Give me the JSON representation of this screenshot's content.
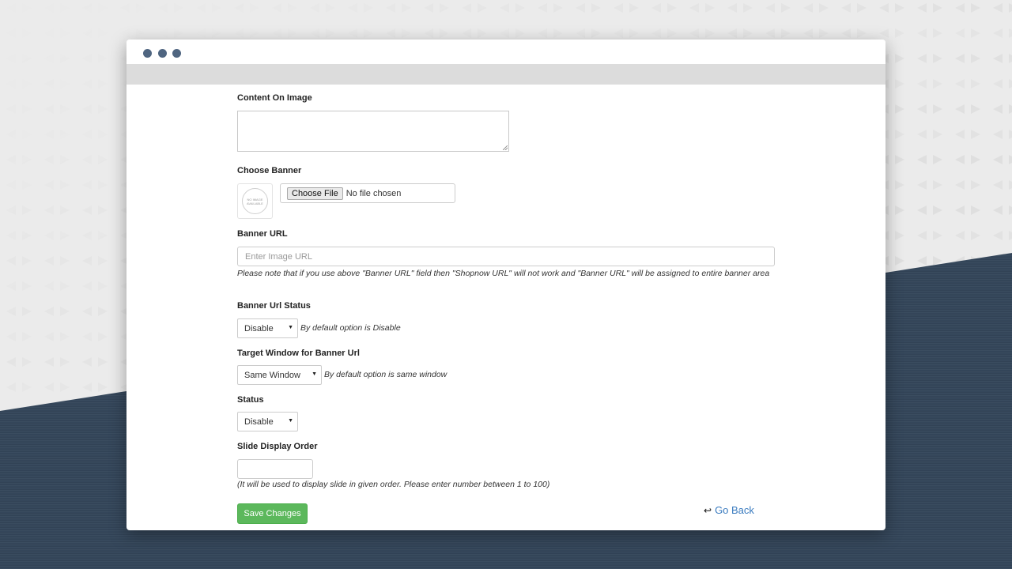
{
  "window": {
    "controls": [
      "dot",
      "dot",
      "dot"
    ]
  },
  "form": {
    "content_on_image": {
      "label": "Content On Image",
      "value": ""
    },
    "choose_banner": {
      "label": "Choose Banner",
      "thumbnail_text": "NO IMAGE AVAILABLE",
      "file_button_label": "Choose File",
      "file_status": "No file chosen"
    },
    "banner_url": {
      "label": "Banner URL",
      "value": "",
      "placeholder": "Enter Image URL",
      "note": "Please note that if you use above \"Banner URL\" field then \"Shopnow URL\" will not work and \"Banner URL\" will be assigned to entire banner area"
    },
    "banner_url_status": {
      "label": "Banner Url Status",
      "selected": "Disable",
      "note": "By default option is Disable"
    },
    "target_window": {
      "label": "Target Window for Banner Url",
      "selected": "Same Window",
      "note": "By default option is same window"
    },
    "status": {
      "label": "Status",
      "selected": "Disable"
    },
    "slide_display_order": {
      "label": "Slide Display Order",
      "value": "",
      "note": "(It will be used to display slide in given order. Please enter number between 1 to 100)"
    },
    "save_button_label": "Save Changes",
    "go_back_label": "Go Back"
  },
  "colors": {
    "save_button": "#5cb85c",
    "link": "#3a7bbf",
    "window_dots": "#4f6580",
    "background_dark": "#34465a"
  }
}
